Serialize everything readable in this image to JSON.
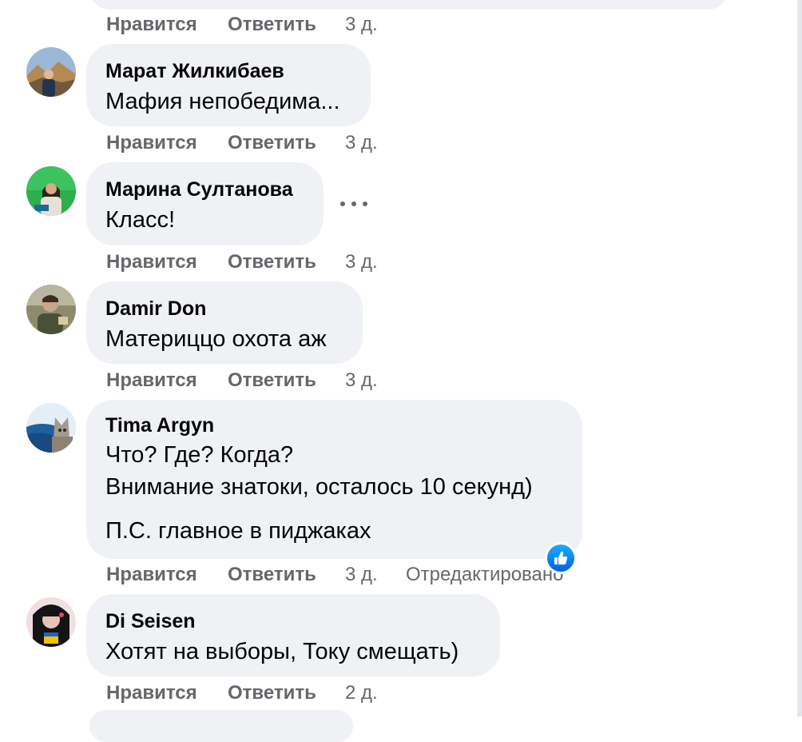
{
  "labels": {
    "like": "Нравится",
    "reply": "Ответить"
  },
  "previous_comment": {
    "time": "3 д."
  },
  "comments": [
    {
      "author": "Марат Жилкибаев",
      "lines": [
        "Мафия непобедима..."
      ],
      "time": "3 д.",
      "avatar": "mountain-portrait"
    },
    {
      "author": "Марина Султанова",
      "lines": [
        "Класс!"
      ],
      "time": "3 д.",
      "avatar": "green-screen-portrait"
    },
    {
      "author": "Damir Don",
      "lines": [
        "Материццо охота аж"
      ],
      "time": "3 д.",
      "avatar": "man-portrait"
    },
    {
      "author": "Tima Argyn",
      "lines": [
        "Что? Где? Когда?",
        "Внимание знатоки, осталось 10 секунд)",
        "П.С. главное в пиджаках"
      ],
      "time": "3 д.",
      "edited": "Отредактировано",
      "avatar": "sea-cat-portrait",
      "reaction": "like-reaction-icon"
    },
    {
      "author": "Di Seisen",
      "lines": [
        "Хотят на выборы, Току смещать)"
      ],
      "time": "2 д.",
      "avatar": "woman-portrait"
    }
  ],
  "colors": {
    "bubble": "#eff1f4",
    "text": "#050505",
    "secondary": "#65676b",
    "reaction": "#1877f2"
  },
  "icons": {
    "more": "more-horizontal-icon",
    "reaction": "like-reaction-icon"
  }
}
